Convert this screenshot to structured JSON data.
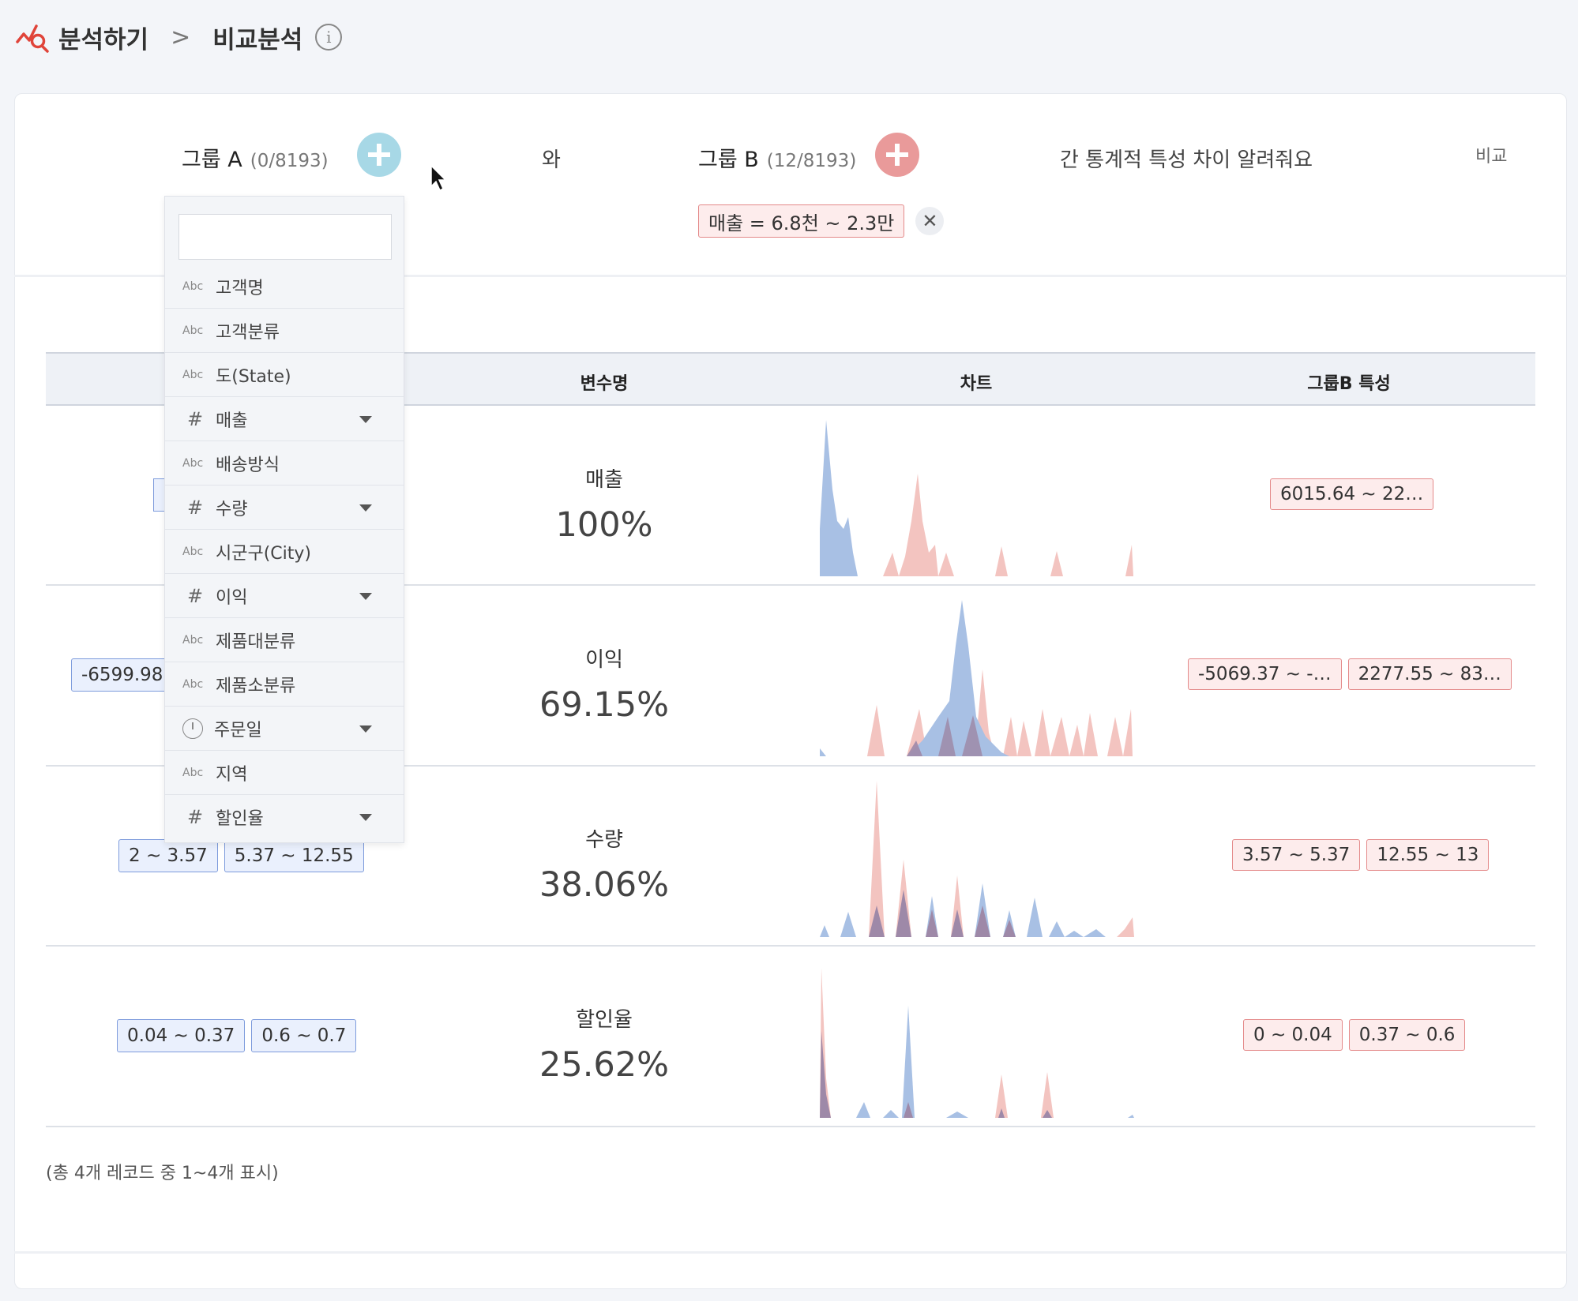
{
  "breadcrumb": {
    "root": "분석하기",
    "separator": ">",
    "current": "비교분석"
  },
  "groupA": {
    "label": "그룹 A",
    "count": "(0/8193)",
    "color": "#a7d8e6"
  },
  "connector": "와",
  "groupB": {
    "label": "그룹 B",
    "count": "(12/8193)",
    "color": "#e99a9a"
  },
  "groupB_filter": "매출 = 6.8천 ~ 2.3만",
  "question": "간 통계적 특성 차이 알려줘요",
  "compare_label": "비교",
  "table": {
    "headers": {
      "variable": "변수명",
      "chart": "차트",
      "groupB": "그룹B 특성"
    },
    "rows": [
      {
        "name": "매출",
        "pct": "100%",
        "a_tags": [],
        "b_tags": [
          "6015.64 ~ 22…"
        ]
      },
      {
        "name": "이익",
        "pct": "69.15%",
        "a_tags": [
          "-6599.98"
        ],
        "b_tags": [
          "-5069.37 ~ -…",
          "2277.55 ~ 83…"
        ]
      },
      {
        "name": "수량",
        "pct": "38.06%",
        "a_tags": [
          "2 ~ 3.57",
          "5.37 ~ 12.55"
        ],
        "b_tags": [
          "3.57 ~ 5.37",
          "12.55 ~ 13"
        ]
      },
      {
        "name": "할인율",
        "pct": "25.62%",
        "a_tags": [
          "0.04 ~ 0.37",
          "0.6 ~ 0.7"
        ],
        "b_tags": [
          "0 ~ 0.04",
          "0.37 ~ 0.6"
        ]
      }
    ]
  },
  "footer_note": "(총 4개 레코드 중 1~4개 표시)",
  "dropdown": {
    "search_value": "",
    "items": [
      {
        "type": "Abc",
        "label": "고객명",
        "has_caret": false
      },
      {
        "type": "Abc",
        "label": "고객분류",
        "has_caret": false
      },
      {
        "type": "Abc",
        "label": "도(State)",
        "has_caret": false
      },
      {
        "type": "#",
        "label": "매출",
        "has_caret": true
      },
      {
        "type": "Abc",
        "label": "배송방식",
        "has_caret": false
      },
      {
        "type": "#",
        "label": "수량",
        "has_caret": true
      },
      {
        "type": "Abc",
        "label": "시군구(City)",
        "has_caret": false
      },
      {
        "type": "#",
        "label": "이익",
        "has_caret": true
      },
      {
        "type": "Abc",
        "label": "제품대분류",
        "has_caret": false
      },
      {
        "type": "Abc",
        "label": "제품소분류",
        "has_caret": false
      },
      {
        "type": "clock",
        "label": "주문일",
        "has_caret": true
      },
      {
        "type": "Abc",
        "label": "지역",
        "has_caret": false
      },
      {
        "type": "#",
        "label": "할인율",
        "has_caret": true
      }
    ]
  },
  "colors": {
    "groupA_series": "#a8c0e4",
    "groupB_series": "#f3c4c0",
    "accent_red": "#e0443a"
  }
}
